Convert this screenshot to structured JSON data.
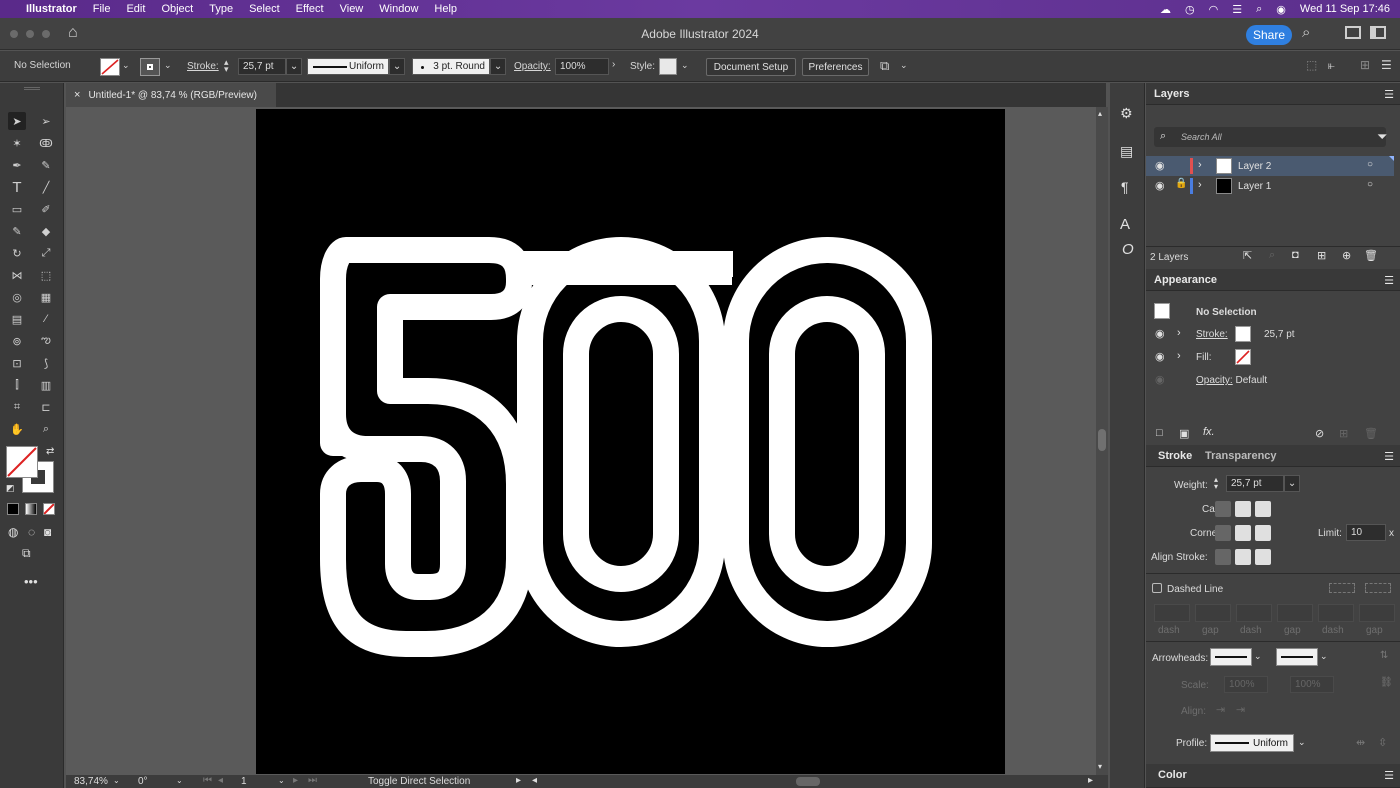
{
  "menubar": {
    "app": "Illustrator",
    "items": [
      "File",
      "Edit",
      "Object",
      "Type",
      "Select",
      "Effect",
      "View",
      "Window",
      "Help"
    ],
    "clock": "Wed 11 Sep  17:46"
  },
  "titlebar": {
    "title": "Adobe Illustrator 2024",
    "share_label": "Share"
  },
  "control": {
    "selection": "No Selection",
    "stroke_label": "Stroke:",
    "stroke_weight": "25,7 pt",
    "profile": "Uniform",
    "brush": "3 pt. Round",
    "opacity_label": "Opacity:",
    "opacity": "100%",
    "style_label": "Style:",
    "doc_setup": "Document Setup",
    "preferences": "Preferences"
  },
  "document": {
    "tab_title": "Untitled-1* @ 83,74 % (RGB/Preview)",
    "art_text": "500"
  },
  "status": {
    "zoom": "83,74%",
    "rotation": "0°",
    "artboard": "1",
    "hint": "Toggle Direct Selection"
  },
  "layers": {
    "title": "Layers",
    "search_placeholder": "Search All",
    "items": [
      {
        "name": "Layer 2",
        "color": "#e05050"
      },
      {
        "name": "Layer 1",
        "color": "#4a7de0"
      }
    ],
    "count": "2 Layers"
  },
  "appearance": {
    "title": "Appearance",
    "selection": "No Selection",
    "stroke_label": "Stroke:",
    "stroke_value": "25,7 pt",
    "fill_label": "Fill:",
    "opacity_label": "Opacity:",
    "opacity_value": "Default"
  },
  "stroke_panel": {
    "tab_stroke": "Stroke",
    "tab_transparency": "Transparency",
    "weight_label": "Weight:",
    "weight": "25,7 pt",
    "cap_label": "Cap:",
    "corner_label": "Corner:",
    "limit_label": "Limit:",
    "limit": "10",
    "limit_unit": "x",
    "align_label": "Align Stroke:",
    "dashed_label": "Dashed Line",
    "dash_labels": [
      "dash",
      "gap",
      "dash",
      "gap",
      "dash",
      "gap"
    ],
    "arrowheads_label": "Arrowheads:",
    "scale_label": "Scale:",
    "scale_values": [
      "100%",
      "100%"
    ],
    "align2_label": "Align:",
    "profile_label": "Profile:",
    "profile": "Uniform"
  },
  "color_panel": {
    "title": "Color"
  },
  "colors": {
    "accent": "#2f7fe0",
    "menubar": "#5a2a8a",
    "selected_row": "#4a5a70"
  }
}
